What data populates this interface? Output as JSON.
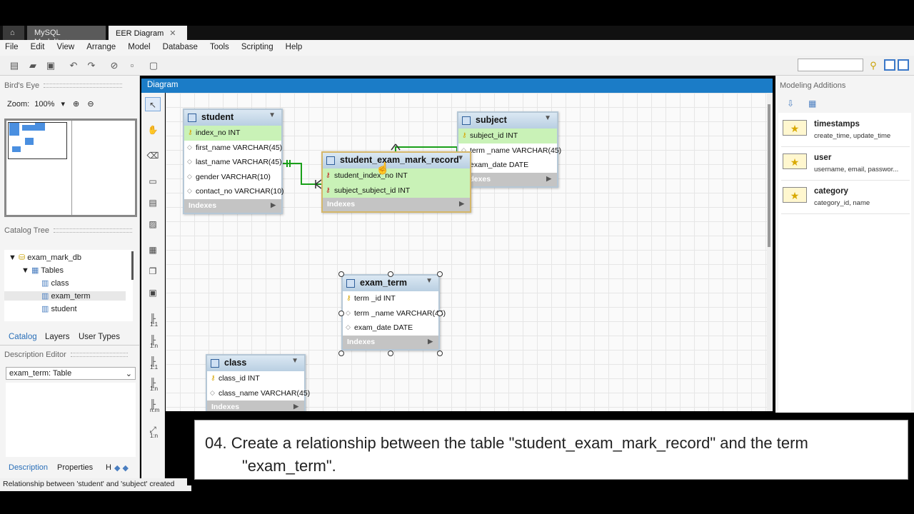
{
  "tabs": [
    {
      "label": "MySQL Model*"
    },
    {
      "label": "EER Diagram"
    }
  ],
  "menu": [
    "File",
    "Edit",
    "View",
    "Arrange",
    "Model",
    "Database",
    "Tools",
    "Scripting",
    "Help"
  ],
  "left": {
    "birds_eye_title": "Bird's Eye",
    "zoom_label": "Zoom:",
    "zoom_value": "100%",
    "catalog_title": "Catalog Tree",
    "tree": {
      "db": "exam_mark_db",
      "tables_label": "Tables",
      "items": [
        "class",
        "exam_term",
        "student"
      ]
    },
    "tabs": [
      "Catalog",
      "Layers",
      "User Types"
    ],
    "desc_title": "Description Editor",
    "desc_select": "exam_term: Table",
    "bottom_tabs": [
      "Description",
      "Properties",
      "H"
    ]
  },
  "diagram": {
    "header": "Diagram",
    "palette_labels": [
      "1:1",
      "1:n",
      "1:1",
      "1:n",
      "n:m",
      "1:n"
    ],
    "indexes_label": "Indexes",
    "tables": {
      "student": {
        "name": "student",
        "columns": [
          "index_no INT",
          "first_name VARCHAR(45)",
          "last_name VARCHAR(45)",
          "gender VARCHAR(10)",
          "contact_no VARCHAR(10)"
        ]
      },
      "record": {
        "name": "student_exam_mark_record",
        "columns": [
          "student_index_no INT",
          "subject_subject_id INT"
        ]
      },
      "subject": {
        "name": "subject",
        "columns": [
          "subject_id INT",
          "term _name VARCHAR(45)",
          "exam_date DATE"
        ]
      },
      "exam_term": {
        "name": "exam_term",
        "columns": [
          "term _id INT",
          "term _name VARCHAR(45)",
          "exam_date DATE"
        ]
      },
      "class": {
        "name": "class",
        "columns": [
          "class_id INT",
          "class_name VARCHAR(45)"
        ]
      }
    }
  },
  "right": {
    "title": "Modeling Additions",
    "snippets": [
      {
        "name": "timestamps",
        "desc": "create_time, update_time"
      },
      {
        "name": "user",
        "desc": "username, email, passwor..."
      },
      {
        "name": "category",
        "desc": "category_id, name"
      }
    ]
  },
  "status": "Relationship between 'student' and 'subject' created",
  "caption": {
    "line1": "04. Create a relationship between the table \"student_exam_mark_record\" and the term",
    "line2": "\"exam_term\"."
  }
}
